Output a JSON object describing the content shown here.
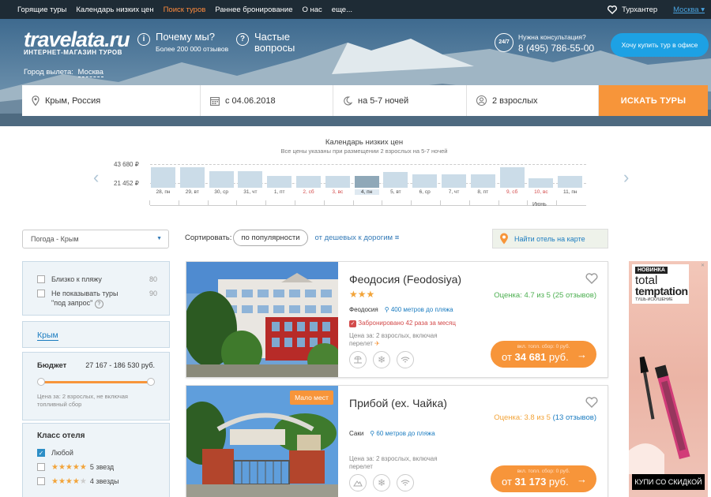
{
  "nav": {
    "items": [
      "Горящие туры",
      "Календарь низких цен",
      "Поиск туров",
      "Раннее бронирование",
      "О нас",
      "еще..."
    ],
    "active_index": 2,
    "account": "Турхантер",
    "city": "Москва"
  },
  "header": {
    "logo": "travelata.ru",
    "logo_sub": "ИНТЕРНЕТ-МАГАЗИН ТУРОВ",
    "why_title": "Почему мы?",
    "why_sub": "Более 200 000 отзывов",
    "faq_title": "Частые вопросы",
    "consult_label": "Нужна консультация?",
    "consult_phone": "8 (495) 786-55-00",
    "consult_badge": "24/7",
    "office_button": "Хочу купить тур в офисе",
    "departure_label": "Город вылета:",
    "departure_city": "Москва"
  },
  "search": {
    "destination": "Крым, Россия",
    "date": "с 04.06.2018",
    "nights": "на 5-7 ночей",
    "guests": "2 взрослых",
    "button": "ИСКАТЬ ТУРЫ"
  },
  "calendar": {
    "title": "Календарь низких цен",
    "subtitle": "Все цены указаны при размещении 2 взрослых на 5-7 ночей",
    "price_high": "43 680 ₽",
    "price_low": "21 452 ₽",
    "month": "Июнь",
    "days": [
      {
        "label": "28, пн",
        "level": 0.85,
        "weekend": false
      },
      {
        "label": "29, вт",
        "level": 0.85,
        "weekend": false
      },
      {
        "label": "30, ср",
        "level": 0.7,
        "weekend": false
      },
      {
        "label": "31, чт",
        "level": 0.7,
        "weekend": false
      },
      {
        "label": "1, пт",
        "level": 0.5,
        "weekend": false
      },
      {
        "label": "2, сб",
        "level": 0.5,
        "weekend": true
      },
      {
        "label": "3, вс",
        "level": 0.5,
        "weekend": true
      },
      {
        "label": "4, пн",
        "level": 0.5,
        "weekend": false,
        "selected": true
      },
      {
        "label": "5, вт",
        "level": 0.65,
        "weekend": false
      },
      {
        "label": "6, ср",
        "level": 0.55,
        "weekend": false
      },
      {
        "label": "7, чт",
        "level": 0.55,
        "weekend": false
      },
      {
        "label": "8, пт",
        "level": 0.55,
        "weekend": false
      },
      {
        "label": "9, сб",
        "level": 0.85,
        "weekend": true
      },
      {
        "label": "10, вс",
        "level": 0.4,
        "weekend": true
      },
      {
        "label": "11, пн",
        "level": 0.5,
        "weekend": false
      }
    ]
  },
  "filters": {
    "weather_select": "Погода - Крым",
    "checks": [
      {
        "label": "Близко к пляжу",
        "count": "80"
      },
      {
        "label": "Не показывать туры \"под запрос\"",
        "count": "90"
      }
    ],
    "region": "Крым",
    "budget_label": "Бюджет",
    "budget_range": "27 167 - 186 530 руб.",
    "budget_note": "Цена за: 2 взрослых, не включая топливный сбор",
    "class_title": "Класс отеля",
    "classes": [
      {
        "label": "Любой",
        "checked": true,
        "stars": 0
      },
      {
        "label": "5 звезд",
        "checked": false,
        "stars": 5
      },
      {
        "label": "4 звезды",
        "checked": false,
        "stars": 4
      }
    ]
  },
  "sort": {
    "label": "Сортировать:",
    "current": "по популярности",
    "alt": "от дешевых к дорогим"
  },
  "map_button": "Найти отель на карте",
  "hotels": [
    {
      "name": "Феодосия (Feodosiya)",
      "stars": 3,
      "rating_label": "Оценка:",
      "rating": "4.7",
      "rating_of": "из 5",
      "reviews": "(25 отзывов)",
      "rating_color": "#4caf50",
      "city": "Феодосия",
      "distance": "400 метров до пляжа",
      "booked": "Забронировано 42 раза за месяц",
      "price_note": "Цена за: 2 взрослых, включая перелет",
      "fee": "вкл. топл. сбор: 0 руб.",
      "price_prefix": "от",
      "price": "34 681",
      "currency": "руб."
    },
    {
      "name": "Прибой (ех. Чайка)",
      "badge": "Мало мест",
      "rating_label": "Оценка:",
      "rating": "3.8",
      "rating_of": "из 5",
      "reviews": "(13 отзывов)",
      "rating_color": "#f2a43a",
      "city": "Саки",
      "distance": "60 метров до пляжа",
      "price_note": "Цена за: 2 взрослых, включая перелет",
      "fee": "вкл. топл. сбор: 0 руб.",
      "price_prefix": "от",
      "price": "31 173",
      "currency": "руб."
    }
  ],
  "ad": {
    "badge": "НОВИНКА",
    "brand1": "total",
    "brand2": "temptation",
    "sub": "ТУШЬ-ИСКУШЕНИЕ",
    "cta": "КУПИ СО СКИДКОЙ"
  }
}
